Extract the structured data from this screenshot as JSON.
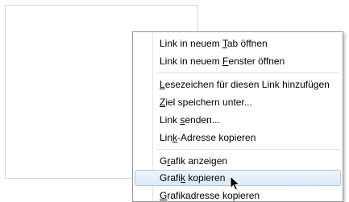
{
  "image": {
    "icon": "sunflower-image"
  },
  "context_menu": {
    "items": [
      {
        "label": "Link in neuem Tab öffnen",
        "accel": "T"
      },
      {
        "label": "Link in neuem Fenster öffnen",
        "accel": "F"
      },
      {
        "label": "Lesezeichen für diesen Link hinzufügen",
        "accel": "L"
      },
      {
        "label": "Ziel speichern unter...",
        "accel": "Z"
      },
      {
        "label": "Link senden...",
        "accel": "s"
      },
      {
        "label": "Link-Adresse kopieren",
        "accel": "k"
      },
      {
        "label": "Grafik anzeigen",
        "accel": "r"
      },
      {
        "label": "Grafik kopieren",
        "accel": "k",
        "highlighted": true
      },
      {
        "label": "Grafikadresse kopieren",
        "accel": "G"
      }
    ]
  },
  "colors": {
    "highlight_border": "#a8c8ed",
    "menu_border": "#979797",
    "sky": "#1d4aa3"
  }
}
